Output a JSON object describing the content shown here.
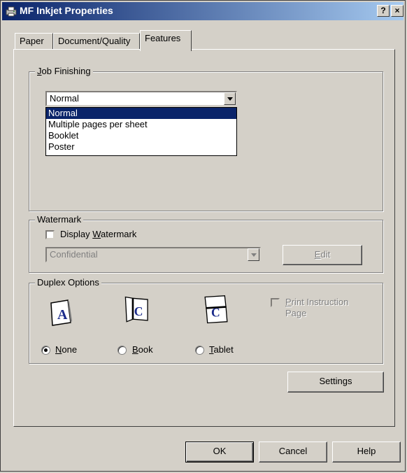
{
  "window": {
    "title": "MF Inkjet Properties",
    "help_glyph": "?",
    "close_glyph": "×"
  },
  "tabs": [
    {
      "label": "Paper"
    },
    {
      "label": "Document/Quality"
    },
    {
      "label": "Features",
      "active": true
    }
  ],
  "job_finishing": {
    "group_label_accel": "J",
    "group_label_rest": "ob Finishing",
    "selected_value": "Normal",
    "options": [
      "Normal",
      "Multiple pages per sheet",
      "Booklet",
      "Poster"
    ]
  },
  "watermark": {
    "group_label": "Watermark",
    "display_label_pre": "Display ",
    "display_label_accel": "W",
    "display_label_post": "atermark",
    "display_checked": false,
    "selected_value": "Confidential",
    "edit_accel": "E",
    "edit_rest": "dit"
  },
  "duplex": {
    "group_label": "Duplex Options",
    "options": [
      {
        "accel": "N",
        "rest": "one",
        "checked": true,
        "icon_letter": "A"
      },
      {
        "accel": "B",
        "rest": "ook",
        "checked": false,
        "icon_letter": "C"
      },
      {
        "accel": "T",
        "rest": "ablet",
        "checked": false,
        "icon_letter": "C"
      }
    ],
    "print_instruction_accel": "P",
    "print_instruction_rest": "rint Instruction",
    "print_instruction_line2": "Page"
  },
  "settings_label": "Settings",
  "buttons": {
    "ok": "OK",
    "cancel": "Cancel",
    "help": "Help"
  },
  "colors": {
    "titlebar": "#0a246a",
    "face": "#d4d0c8",
    "selection": "#0a246a",
    "icon_text": "#1a2a8a"
  }
}
